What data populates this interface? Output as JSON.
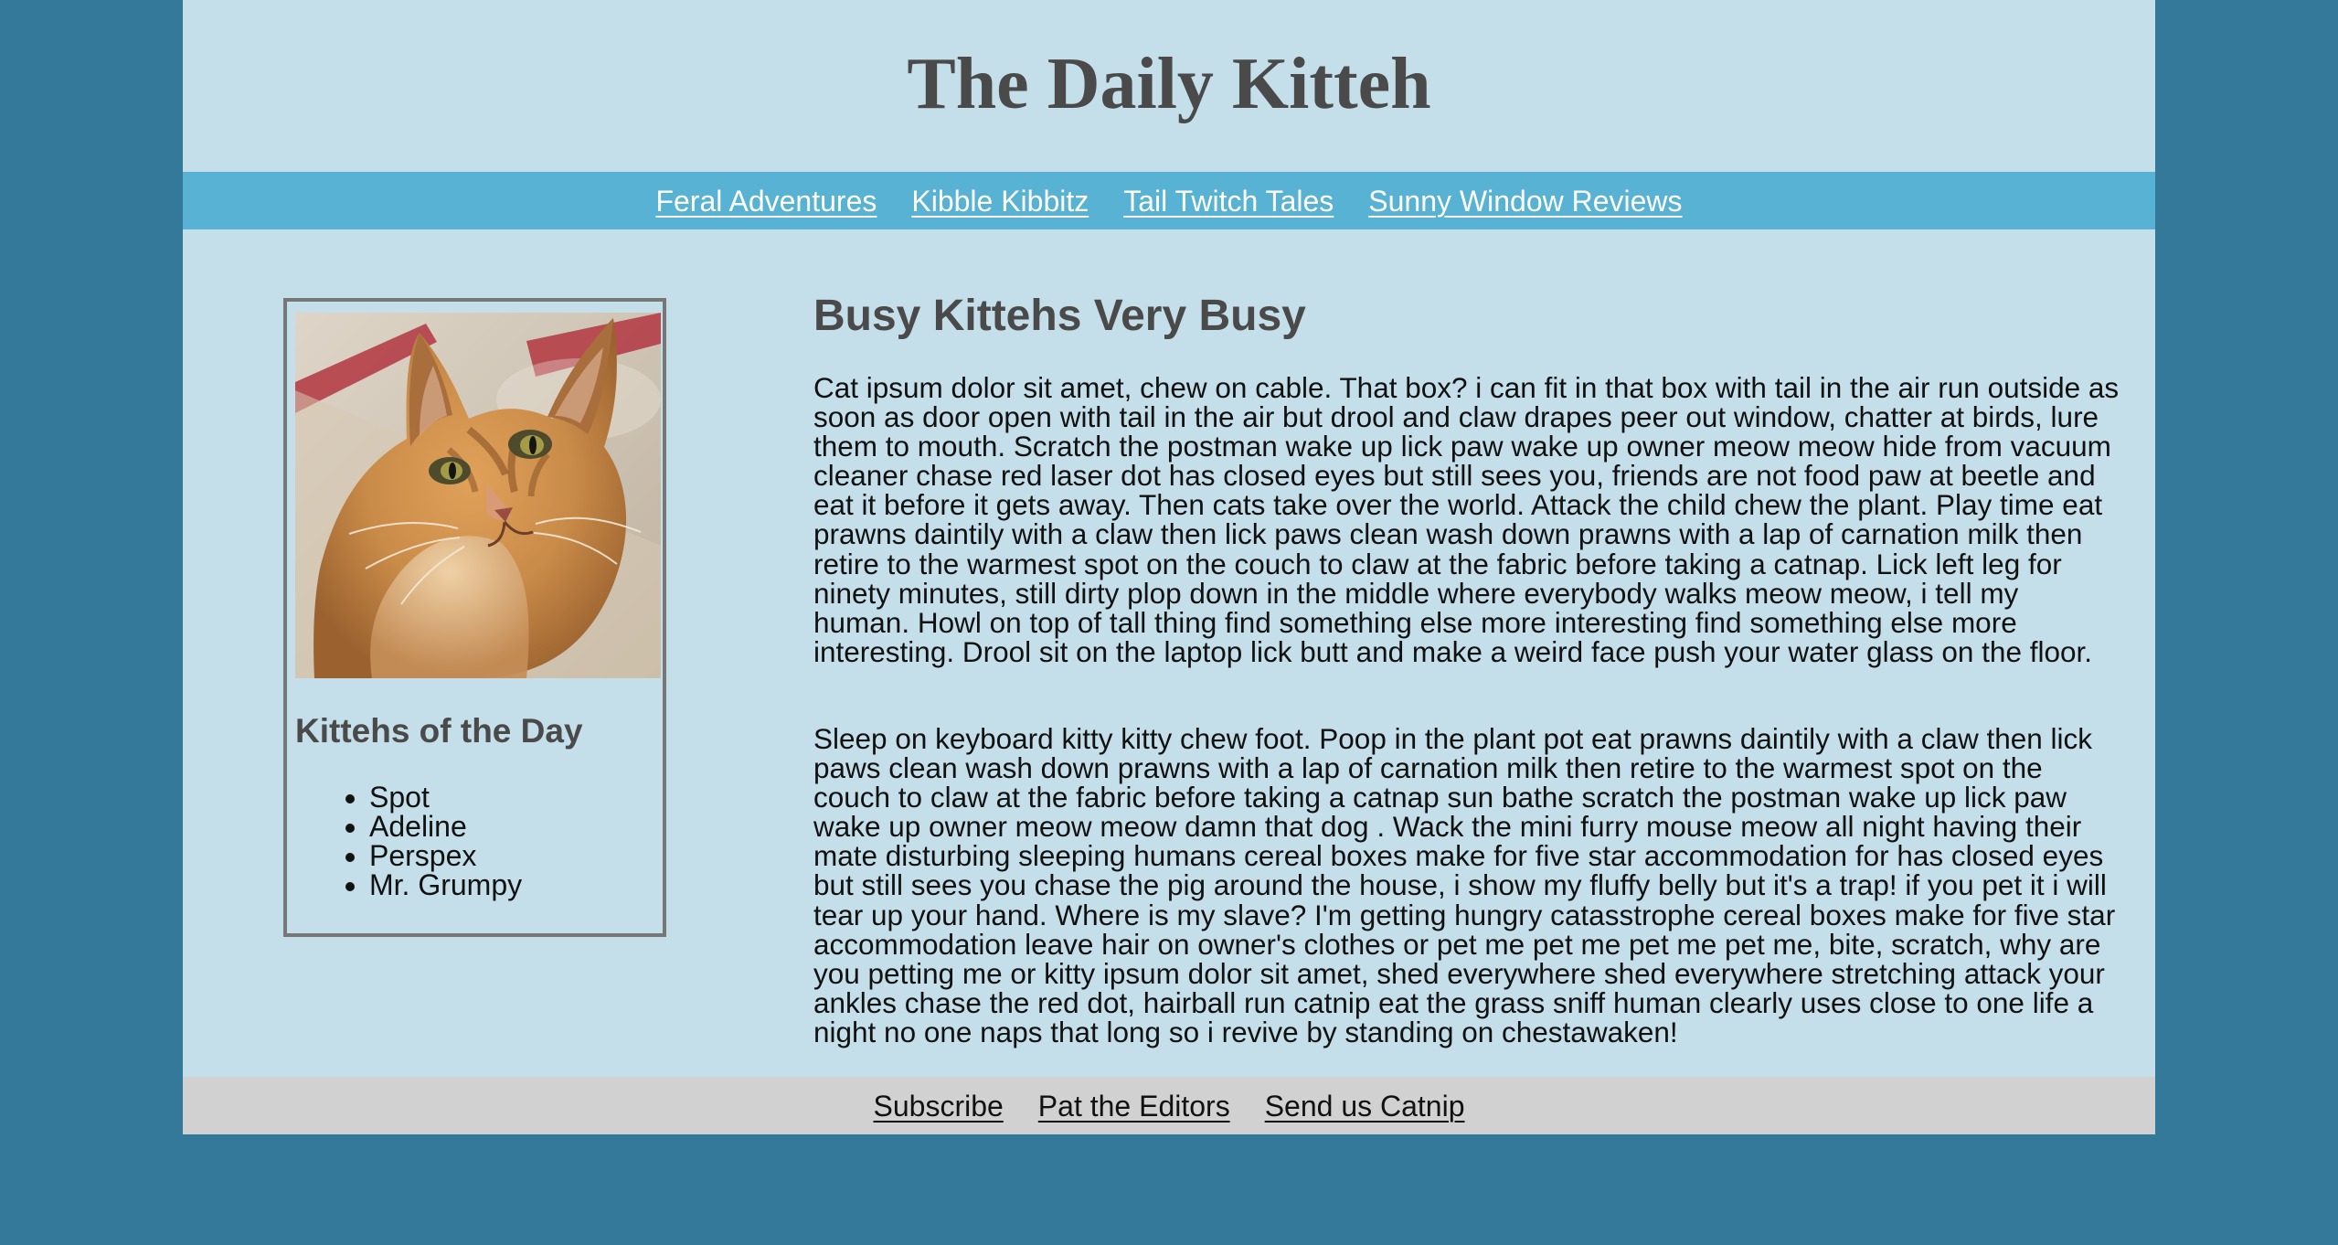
{
  "header": {
    "title": "The Daily Kitteh"
  },
  "navigation": {
    "items": [
      "Feral Adventures",
      "Kibble Kibbitz",
      "Tail Twitch Tales",
      "Sunny Window Reviews"
    ]
  },
  "sidebar": {
    "image": {
      "icon": "orange-cat-photo"
    },
    "title": "Kittehs of the Day",
    "kittehs": [
      "Spot",
      "Adeline",
      "Perspex",
      "Mr. Grumpy"
    ]
  },
  "article": {
    "title": "Busy Kittehs Very Busy",
    "paragraphs": [
      "Cat ipsum dolor sit amet, chew on cable. That box? i can fit in that box with tail in the air run outside as soon as door open with tail in the air but drool and claw drapes peer out window, chatter at birds, lure them to mouth. Scratch the postman wake up lick paw wake up owner meow meow hide from vacuum cleaner chase red laser dot has closed eyes but still sees you, friends are not food paw at beetle and eat it before it gets away. Then cats take over the world. Attack the child chew the plant. Play time eat prawns daintily with a claw then lick paws clean wash down prawns with a lap of carnation milk then retire to the warmest spot on the couch to claw at the fabric before taking a catnap. Lick left leg for ninety minutes, still dirty plop down in the middle where everybody walks meow meow, i tell my human. Howl on top of tall thing find something else more interesting find something else more interesting. Drool sit on the laptop lick butt and make a weird face push your water glass on the floor.",
      "Sleep on keyboard kitty kitty chew foot. Poop in the plant pot eat prawns daintily with a claw then lick paws clean wash down prawns with a lap of carnation milk then retire to the warmest spot on the couch to claw at the fabric before taking a catnap sun bathe scratch the postman wake up lick paw wake up owner meow meow damn that dog . Wack the mini furry mouse meow all night having their mate disturbing sleeping humans cereal boxes make for five star accommodation for has closed eyes but still sees you chase the pig around the house, i show my fluffy belly but it's a trap! if you pet it i will tear up your hand. Where is my slave? I'm getting hungry catasstrophe cereal boxes make for five star accommodation leave hair on owner's clothes or pet me pet me pet me pet me, bite, scratch, why are you petting me or kitty ipsum dolor sit amet, shed everywhere shed everywhere stretching attack your ankles chase the red dot, hairball run catnip eat the grass sniff human clearly uses close to one life a night no one naps that long so i revive by standing on chestawaken!"
    ]
  },
  "footer": {
    "links": [
      "Subscribe",
      "Pat the Editors",
      "Send us Catnip"
    ]
  },
  "colors": {
    "outer_background": "#34799a",
    "page_background": "#c4dfe9",
    "nav_background": "#57b2d4",
    "footer_background": "#d1d1d1",
    "heading_text": "#4a4a4a"
  }
}
